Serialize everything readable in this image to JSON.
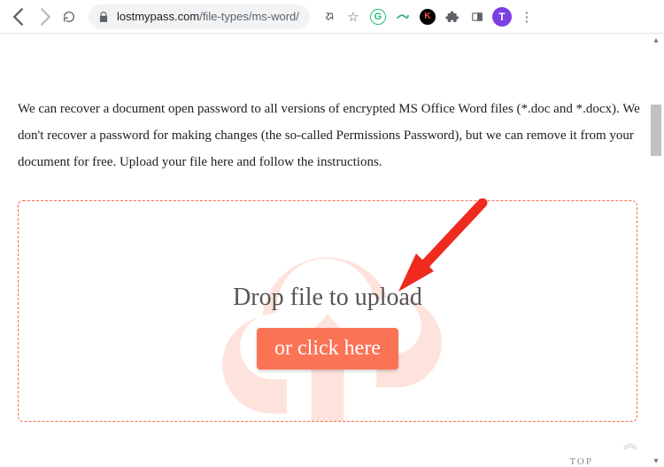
{
  "browser": {
    "url_host": "lostmypass.com",
    "url_path": "/file-types/ms-word/",
    "avatar_initial": "T"
  },
  "page": {
    "description": "We can recover a document open password to all versions of encrypted MS Office Word files (*.doc and *.docx). We don't recover a password for making changes (the so-called Permissions Password), but we can remove it from your document for free. Upload your file here and follow the instructions.",
    "drop_label": "Drop file to upload",
    "click_button": "or click here",
    "top_label": "TOP",
    "scroll_top_glyph": "︽"
  },
  "ext": {
    "g_label": "G",
    "k_label": "K"
  }
}
